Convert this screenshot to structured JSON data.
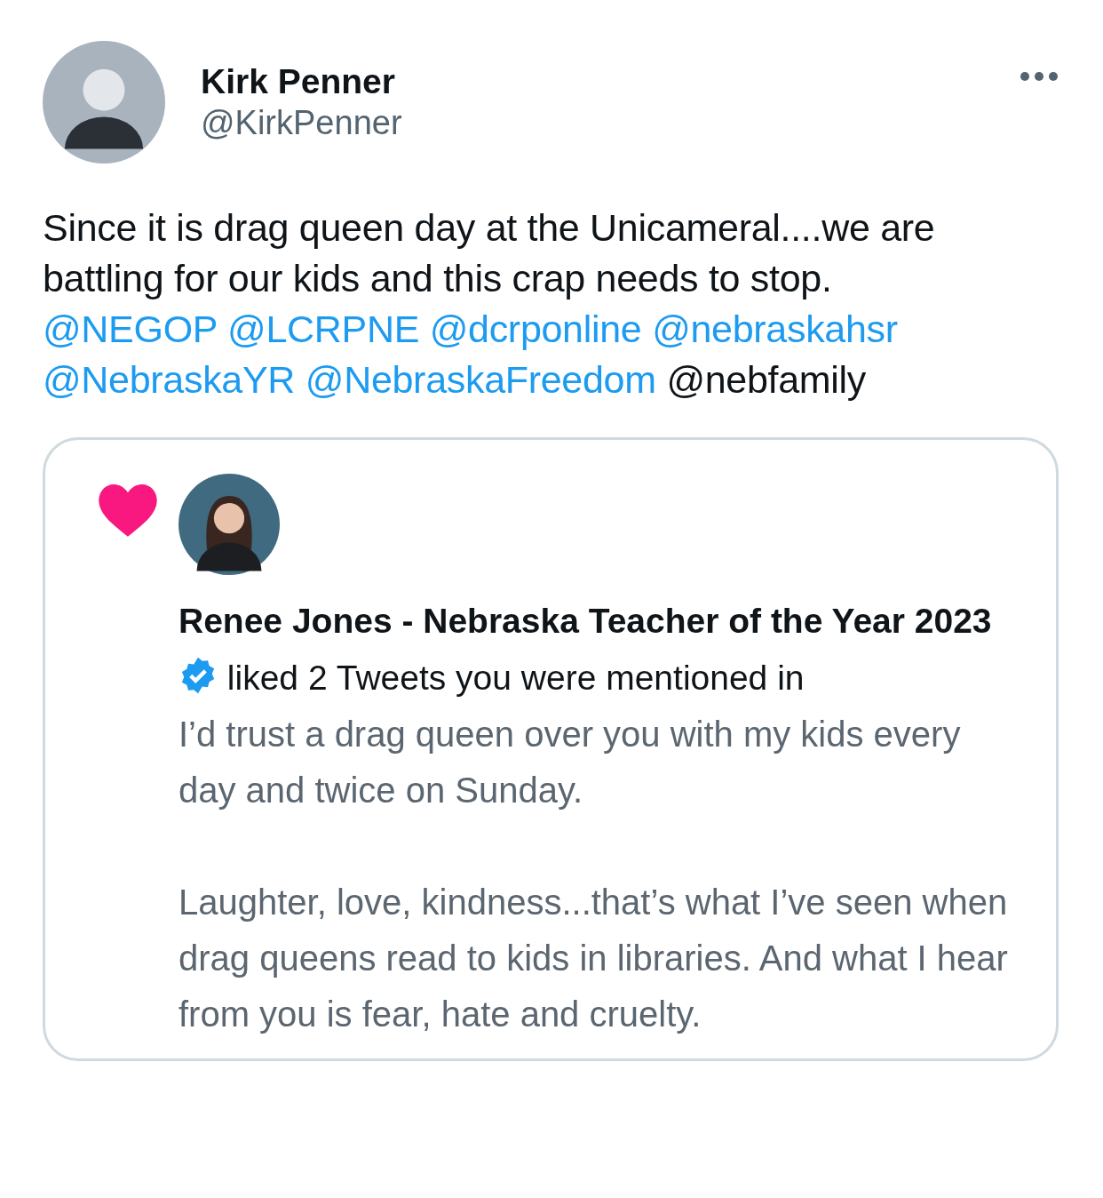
{
  "author": {
    "name": "Kirk Penner",
    "handle": "@KirkPenner"
  },
  "tweet": {
    "text": "Since it is drag queen day at the Unicameral....we are battling for our kids and this crap needs to stop.",
    "mentions": [
      {
        "text": "@NEGOP",
        "linked": true
      },
      {
        "text": "@LCRPNE",
        "linked": true
      },
      {
        "text": "@dcrponline",
        "linked": true
      },
      {
        "text": "@nebraskahsr",
        "linked": true
      },
      {
        "text": "@NebraskaYR",
        "linked": true
      },
      {
        "text": "@NebraskaFreedom",
        "linked": true
      },
      {
        "text": "@nebfamily",
        "linked": false
      }
    ]
  },
  "notification": {
    "actor": "Renee Jones - Nebraska Teacher of the Year 2023",
    "verified": true,
    "action": "liked 2 Tweets you were mentioned in",
    "quoted": [
      "I’d trust a drag queen over you with my kids every day and twice on Sunday.",
      "Laughter, love, kindness...that’s what I’ve seen when drag queens read to kids in libraries. And what I hear from you is fear, hate and cruelty."
    ]
  }
}
